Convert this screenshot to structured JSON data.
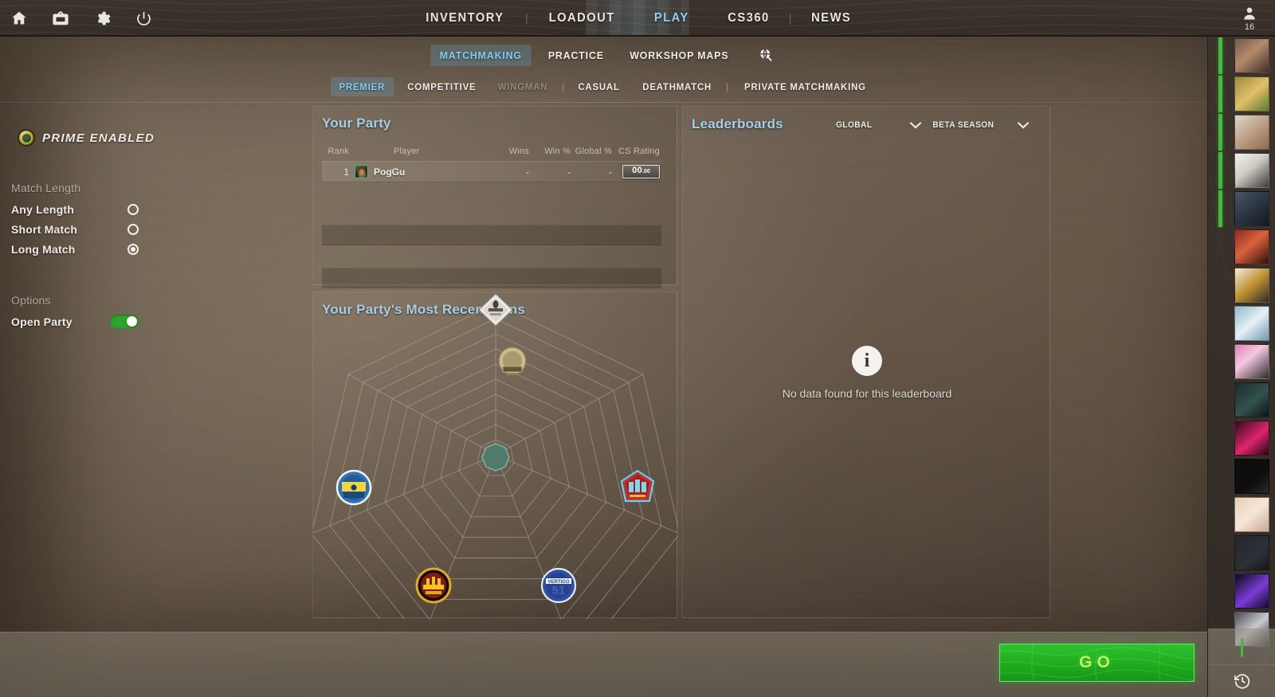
{
  "topbar": {
    "icons": [
      {
        "name": "home-icon",
        "label": "Home"
      },
      {
        "name": "tv-icon",
        "label": "Watch"
      },
      {
        "name": "gear-icon",
        "label": "Settings"
      },
      {
        "name": "power-icon",
        "label": "Quit"
      }
    ],
    "nav": [
      {
        "label": "INVENTORY",
        "active": false
      },
      {
        "label": "LOADOUT",
        "active": false
      },
      {
        "label": "PLAY",
        "active": true
      },
      {
        "label": "CS360",
        "active": false
      },
      {
        "label": "NEWS",
        "active": false
      }
    ],
    "profile": {
      "friend_count": "16"
    }
  },
  "subnav": {
    "items": [
      {
        "label": "MATCHMAKING",
        "active": true
      },
      {
        "label": "PRACTICE",
        "active": false
      },
      {
        "label": "WORKSHOP MAPS",
        "active": false
      }
    ],
    "globe_icon": "globe-search-icon"
  },
  "modes": {
    "items": [
      {
        "label": "PREMIER",
        "active": true,
        "disabled": false
      },
      {
        "label": "COMPETITIVE",
        "active": false,
        "disabled": false
      },
      {
        "label": "WINGMAN",
        "active": false,
        "disabled": true
      },
      {
        "label": "CASUAL",
        "active": false,
        "disabled": false
      },
      {
        "label": "DEATHMATCH",
        "active": false,
        "disabled": false
      },
      {
        "label": "PRIVATE MATCHMAKING",
        "active": false,
        "disabled": false
      }
    ]
  },
  "sidebar": {
    "prime_label": "PRIME ENABLED",
    "match_length_label": "Match Length",
    "match_length_options": [
      {
        "label": "Any Length",
        "selected": false
      },
      {
        "label": "Short Match",
        "selected": false
      },
      {
        "label": "Long Match",
        "selected": true
      }
    ],
    "options_label": "Options",
    "open_party_label": "Open Party",
    "open_party_on": true
  },
  "party": {
    "title": "Your Party",
    "columns": [
      "Rank",
      "Player",
      "Wins",
      "Win %",
      "Global %",
      "CS Rating"
    ],
    "rows": [
      {
        "rank": "1",
        "player": "PogGu",
        "wins": "-",
        "win_pct": "-",
        "global_pct": "-",
        "rating_int": "00",
        "rating_dec": ".00"
      }
    ],
    "empty_slots": 2
  },
  "wins": {
    "title": "Your Party's Most Recent Wins",
    "chart_data": {
      "type": "radar",
      "title": "Your Party's Most Recent Wins",
      "axes": [
        "Anubis",
        "Ancient",
        "Nuke",
        "Overpass",
        "Vertigo",
        "Mirage",
        ""
      ],
      "values": [
        0,
        0,
        0,
        0,
        0,
        0,
        0
      ],
      "rings": 10,
      "axis_count": 7,
      "grid": true,
      "center_color": "#5f9e8b",
      "maps": [
        {
          "name": "Anubis",
          "label": "ANUBIS",
          "angle": -90,
          "color": "#e9e7e0"
        },
        {
          "name": "Ancient",
          "label": "ANCIENT",
          "angle": -141,
          "color": "#cdbf8f"
        },
        {
          "name": "Nuke",
          "label": "NUKE",
          "angle": -193,
          "color": "#2f74b5"
        },
        {
          "name": "Overpass",
          "label": "OVERPASS",
          "angle": 115,
          "color": "#e0a520"
        },
        {
          "name": "Vertigo",
          "label": "VERTIGO",
          "angle": 64,
          "color": "#2f4fa8"
        },
        {
          "name": "Mirage",
          "label": "MIRAGE",
          "angle": 12,
          "color": "#c83030"
        }
      ]
    }
  },
  "leaderboards": {
    "title": "Leaderboards",
    "region_filter": "GLOBAL",
    "season_filter": "BETA SEASON",
    "empty_message": "No data found for this leaderboard",
    "empty_icon": "info-icon"
  },
  "bottom": {
    "go_label": "GO"
  },
  "rail": {
    "friends": [
      {
        "online": true,
        "c1": "#6e5a4e",
        "c2": "#b58a6b"
      },
      {
        "online": true,
        "c1": "#9c8a3e",
        "c2": "#e0c06a"
      },
      {
        "online": true,
        "c1": "#dcd6cf",
        "c2": "#b79478"
      },
      {
        "online": true,
        "c1": "#f2f0ec",
        "c2": "#3a3a3a"
      },
      {
        "online": true,
        "c1": "#4a5565",
        "c2": "#2a3240"
      },
      {
        "online": false,
        "c1": "#8e2a24",
        "c2": "#d9623c"
      },
      {
        "online": false,
        "c1": "#2b2b2b",
        "c2": "#c2922f"
      },
      {
        "online": false,
        "c1": "#8fb9cd",
        "c2": "#e6f1f6"
      },
      {
        "online": false,
        "c1": "#e07fb8",
        "c2": "#f5c8e0"
      },
      {
        "online": false,
        "c1": "#1d2a28",
        "c2": "#33524d"
      },
      {
        "online": false,
        "c1": "#2a0d18",
        "c2": "#e0246c"
      },
      {
        "online": false,
        "c1": "#0d0d0d",
        "c2": "#ffffff"
      },
      {
        "online": false,
        "c1": "#e8cdb8",
        "c2": "#f6e6d8"
      },
      {
        "online": false,
        "c1": "#23262b",
        "c2": "#f2f2f2"
      },
      {
        "online": false,
        "c1": "#0a0a12",
        "c2": "#7b3bd6"
      },
      {
        "online": false,
        "c1": "#4a4a52",
        "c2": "#c9c9cf"
      }
    ],
    "mic_icon": "microphone-icon",
    "history_icon": "history-clock-icon"
  }
}
